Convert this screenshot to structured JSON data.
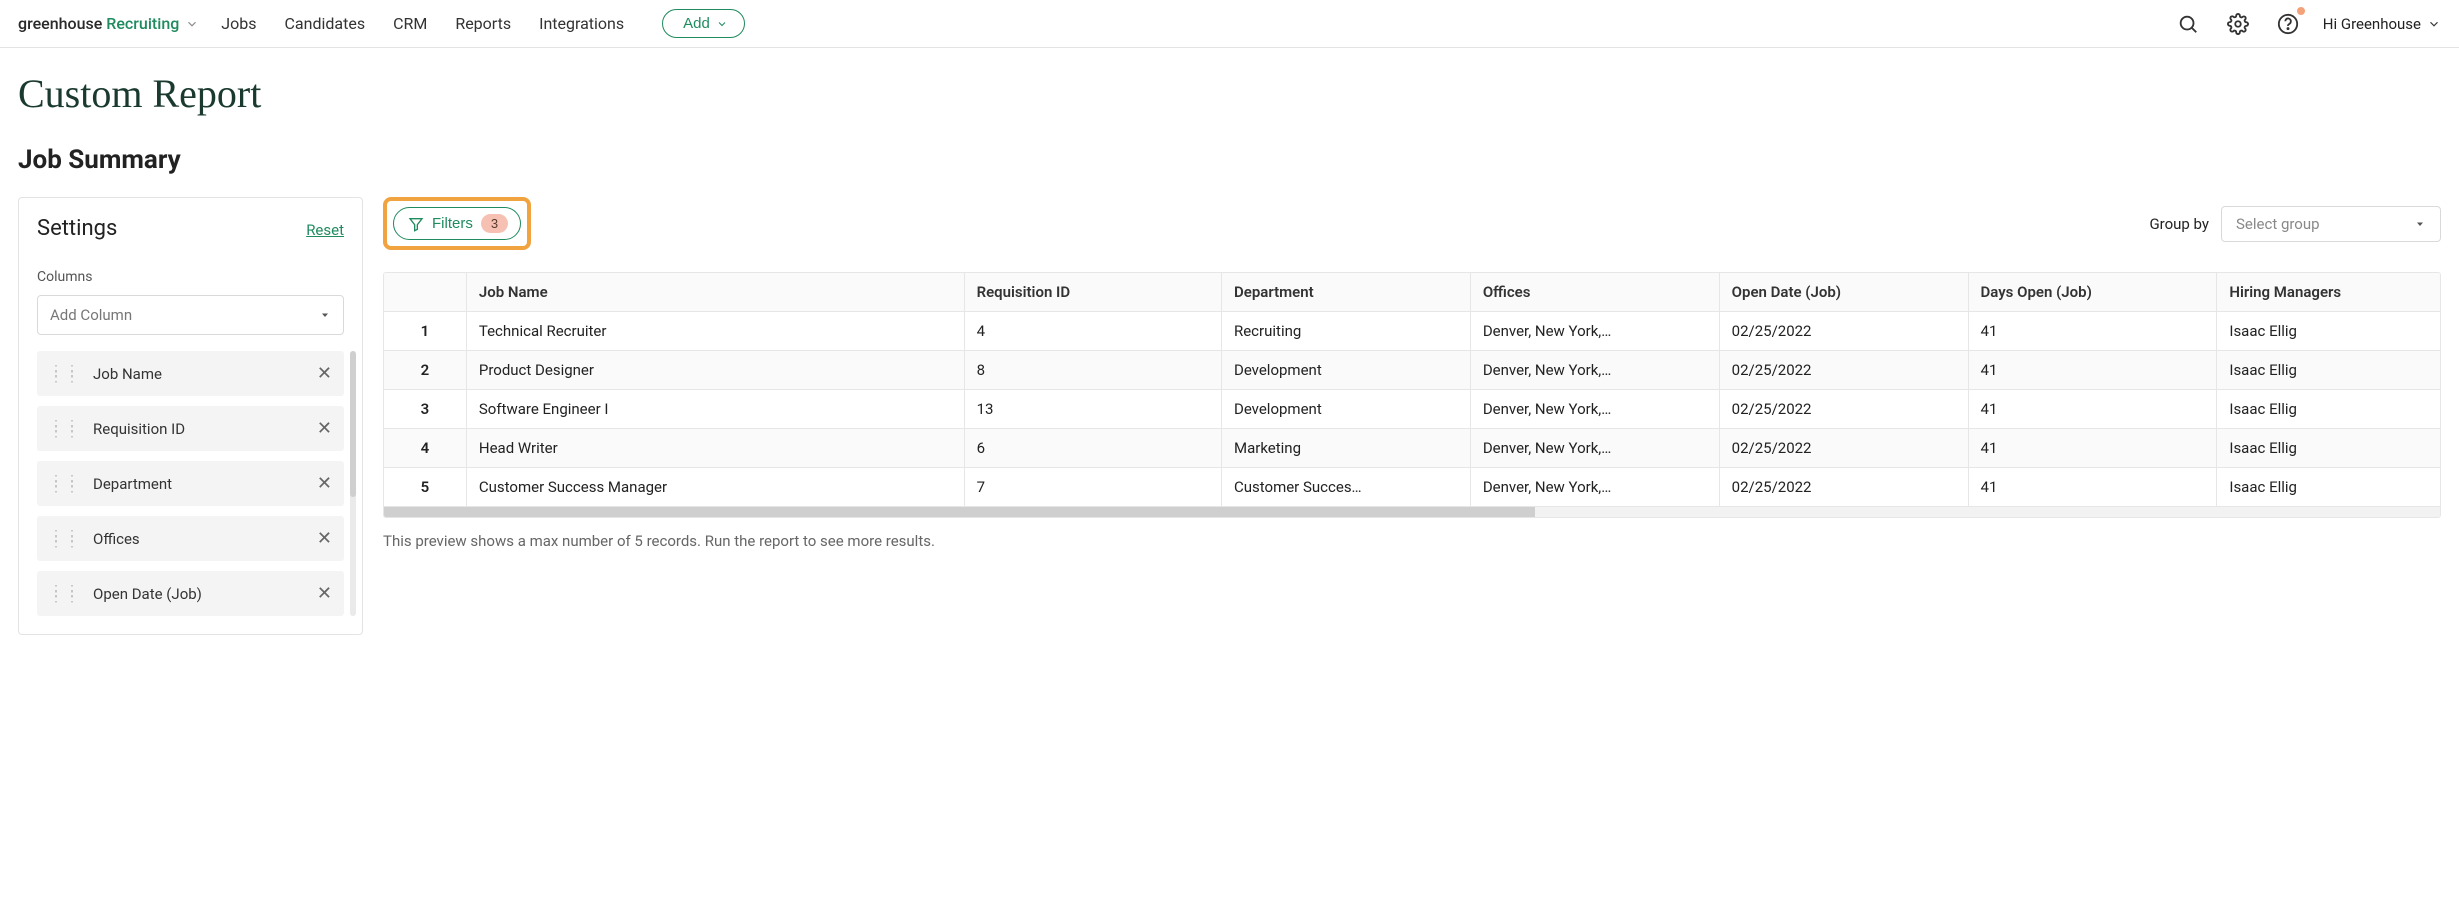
{
  "brand": {
    "part1": "greenhouse",
    "part2": "Recruiting"
  },
  "nav": {
    "jobs": "Jobs",
    "candidates": "Candidates",
    "crm": "CRM",
    "reports": "Reports",
    "integrations": "Integrations",
    "add": "Add"
  },
  "user": {
    "greeting": "Hi Greenhouse"
  },
  "page": {
    "title": "Custom Report",
    "subtitle": "Job Summary"
  },
  "sidebar": {
    "settings_title": "Settings",
    "reset": "Reset",
    "columns_label": "Columns",
    "add_column_placeholder": "Add Column",
    "columns": [
      "Job Name",
      "Requisition ID",
      "Department",
      "Offices",
      "Open Date (Job)"
    ]
  },
  "toolbar": {
    "filters_label": "Filters",
    "filters_count": "3",
    "groupby_label": "Group by",
    "groupby_placeholder": "Select group"
  },
  "table": {
    "headers": [
      "",
      "Job Name",
      "Requisition ID",
      "Department",
      "Offices",
      "Open Date (Job)",
      "Days Open (Job)",
      "Hiring Managers"
    ],
    "rows": [
      {
        "n": "1",
        "job": "Technical Recruiter",
        "req": "4",
        "dept": "Recruiting",
        "off": "Denver, New York,…",
        "open": "02/25/2022",
        "days": "41",
        "hm": "Isaac Ellig"
      },
      {
        "n": "2",
        "job": "Product Designer",
        "req": "8",
        "dept": "Development",
        "off": "Denver, New York,…",
        "open": "02/25/2022",
        "days": "41",
        "hm": "Isaac Ellig"
      },
      {
        "n": "3",
        "job": "Software Engineer I",
        "req": "13",
        "dept": "Development",
        "off": "Denver, New York,…",
        "open": "02/25/2022",
        "days": "41",
        "hm": "Isaac Ellig"
      },
      {
        "n": "4",
        "job": "Head Writer",
        "req": "6",
        "dept": "Marketing",
        "off": "Denver, New York,…",
        "open": "02/25/2022",
        "days": "41",
        "hm": "Isaac Ellig"
      },
      {
        "n": "5",
        "job": "Customer Success Manager",
        "req": "7",
        "dept": "Customer Succes…",
        "off": "Denver, New York,…",
        "open": "02/25/2022",
        "days": "41",
        "hm": "Isaac Ellig"
      }
    ]
  },
  "preview_note": "This preview shows a max number of 5 records. Run the report to see more results."
}
